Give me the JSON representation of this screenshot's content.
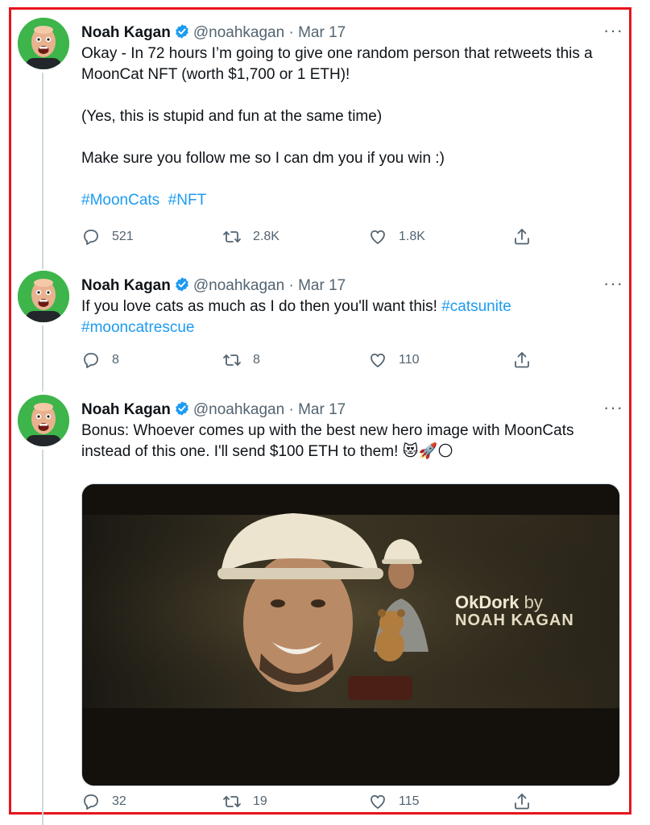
{
  "colors": {
    "link": "#1d9bf0",
    "muted": "#536471",
    "verified": "#1d9bf0",
    "frame": "#e8141c"
  },
  "tweets": [
    {
      "author": {
        "name": "Noah Kagan",
        "handle": "@noahkagan",
        "avatar_icon": "avatar-bald-man-green-bg",
        "verified_icon": "verified-badge-icon"
      },
      "dot": "·",
      "date": "Mar 17",
      "more": "···",
      "paragraphs": [
        "Okay - In 72 hours I’m going to give one random person that retweets this a MoonCat NFT (worth $1,700 or 1 ETH)!",
        "(Yes, this is stupid and fun at the same time)",
        "Make sure you follow me so I can dm you if you win :)"
      ],
      "hashtags": [
        "#MoonCats",
        "#NFT"
      ],
      "stats": {
        "replies": "521",
        "retweets": "2.8K",
        "likes": "1.8K"
      }
    },
    {
      "author": {
        "name": "Noah Kagan",
        "handle": "@noahkagan",
        "avatar_icon": "avatar-bald-man-green-bg",
        "verified_icon": "verified-badge-icon"
      },
      "dot": "·",
      "date": "Mar 17",
      "more": "···",
      "text": "If you love cats as much as I do then you'll want this!",
      "hashtags": [
        "#catsunite",
        "#mooncatrescue"
      ],
      "stats": {
        "replies": "8",
        "retweets": "8",
        "likes": "110"
      }
    },
    {
      "author": {
        "name": "Noah Kagan",
        "handle": "@noahkagan",
        "avatar_icon": "avatar-bald-man-green-bg",
        "verified_icon": "verified-badge-icon"
      },
      "dot": "·",
      "date": "Mar 17",
      "more": "···",
      "text_line1": "Bonus: Whoever comes up with the best new hero image with MoonCats",
      "text_line2": "instead of this one. I'll send $100 ETH to them!",
      "emoji": [
        "😻",
        "🚀",
        "🌕"
      ],
      "media": {
        "title": "OkDork",
        "by": "by",
        "subtitle": "NOAH KAGAN",
        "image_icon": "hero-image-man-in-hard-hat"
      },
      "stats": {
        "replies": "32",
        "retweets": "19",
        "likes": "115"
      }
    }
  ]
}
